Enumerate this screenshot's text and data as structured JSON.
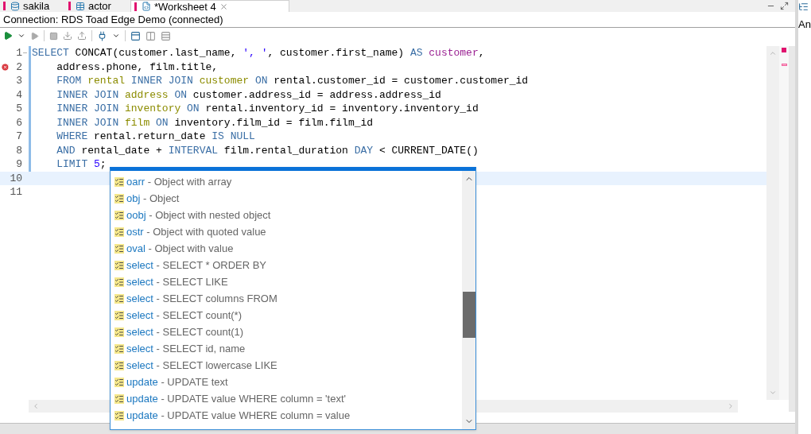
{
  "tabs": [
    {
      "label": "sakila",
      "selected": false,
      "closable": false
    },
    {
      "label": "actor",
      "selected": false,
      "closable": false
    },
    {
      "label": "*Worksheet 4",
      "selected": true,
      "closable": true
    }
  ],
  "connection": "Connection: RDS Toad Edge Demo (connected)",
  "editor": {
    "lines": [
      {
        "number": "1",
        "error": false,
        "changed": true,
        "folding": true,
        "current": false,
        "tokens": [
          {
            "kind": "keyword",
            "text": "SELECT"
          },
          {
            "kind": "plain",
            "text": " CONCAT(customer.last_name, "
          },
          {
            "kind": "string",
            "text": "', '"
          },
          {
            "kind": "plain",
            "text": ", customer.first_name) "
          },
          {
            "kind": "keyword",
            "text": "AS"
          },
          {
            "kind": "alias",
            "text": " customer"
          },
          {
            "kind": "plain",
            "text": ","
          }
        ]
      },
      {
        "number": "2",
        "error": true,
        "changed": true,
        "folding": false,
        "current": false,
        "tokens": [
          {
            "kind": "plain",
            "text": "    address.phone, film.title,"
          }
        ]
      },
      {
        "number": "3",
        "error": false,
        "changed": true,
        "folding": false,
        "current": false,
        "tokens": [
          {
            "kind": "keyword",
            "text": "    FROM"
          },
          {
            "kind": "table",
            "text": " rental"
          },
          {
            "kind": "keyword",
            "text": " INNER JOIN"
          },
          {
            "kind": "table",
            "text": " customer"
          },
          {
            "kind": "keyword",
            "text": " ON"
          },
          {
            "kind": "plain",
            "text": " rental.customer_id = customer.customer_id"
          }
        ]
      },
      {
        "number": "4",
        "error": false,
        "changed": true,
        "folding": false,
        "current": false,
        "tokens": [
          {
            "kind": "keyword",
            "text": "    INNER JOIN"
          },
          {
            "kind": "table",
            "text": " address"
          },
          {
            "kind": "keyword",
            "text": " ON"
          },
          {
            "kind": "plain",
            "text": " customer.address_id = address.address_id"
          }
        ]
      },
      {
        "number": "5",
        "error": false,
        "changed": true,
        "folding": false,
        "current": false,
        "tokens": [
          {
            "kind": "keyword",
            "text": "    INNER JOIN"
          },
          {
            "kind": "table",
            "text": " inventory"
          },
          {
            "kind": "keyword",
            "text": " ON"
          },
          {
            "kind": "plain",
            "text": " rental.inventory_id = inventory.inventory_id"
          }
        ]
      },
      {
        "number": "6",
        "error": false,
        "changed": true,
        "folding": false,
        "current": false,
        "tokens": [
          {
            "kind": "keyword",
            "text": "    INNER JOIN"
          },
          {
            "kind": "table",
            "text": " film"
          },
          {
            "kind": "keyword",
            "text": " ON"
          },
          {
            "kind": "plain",
            "text": " inventory.film_id = film.film_id"
          }
        ]
      },
      {
        "number": "7",
        "error": false,
        "changed": true,
        "folding": false,
        "current": false,
        "tokens": [
          {
            "kind": "keyword",
            "text": "    WHERE"
          },
          {
            "kind": "plain",
            "text": " rental.return_date "
          },
          {
            "kind": "keyword",
            "text": "IS NULL"
          }
        ]
      },
      {
        "number": "8",
        "error": false,
        "changed": true,
        "folding": false,
        "current": false,
        "tokens": [
          {
            "kind": "keyword",
            "text": "    AND"
          },
          {
            "kind": "plain",
            "text": " rental_date + "
          },
          {
            "kind": "keyword",
            "text": "INTERVAL"
          },
          {
            "kind": "plain",
            "text": " film.rental_duration "
          },
          {
            "kind": "keyword",
            "text": "DAY"
          },
          {
            "kind": "plain",
            "text": " < CURRENT_DATE()"
          }
        ]
      },
      {
        "number": "9",
        "error": false,
        "changed": true,
        "folding": false,
        "current": false,
        "tokens": [
          {
            "kind": "keyword",
            "text": "    LIMIT"
          },
          {
            "kind": "number",
            "text": " 5"
          },
          {
            "kind": "plain",
            "text": ";"
          }
        ]
      },
      {
        "number": "10",
        "error": false,
        "changed": false,
        "folding": false,
        "current": true
      },
      {
        "number": "11",
        "error": false,
        "changed": false,
        "folding": false,
        "current": false
      }
    ]
  },
  "completion": [
    {
      "name": "oarr",
      "description": " - Object with array"
    },
    {
      "name": "obj",
      "description": " - Object"
    },
    {
      "name": "oobj",
      "description": " - Object with nested object"
    },
    {
      "name": "ostr",
      "description": " - Object with quoted value"
    },
    {
      "name": "oval",
      "description": " - Object with value"
    },
    {
      "name": "select",
      "description": " - SELECT * ORDER BY"
    },
    {
      "name": "select",
      "description": " - SELECT LIKE"
    },
    {
      "name": "select",
      "description": " - SELECT columns FROM"
    },
    {
      "name": "select",
      "description": " - SELECT count(*)"
    },
    {
      "name": "select",
      "description": " - SELECT count(1)"
    },
    {
      "name": "select",
      "description": " - SELECT id, name"
    },
    {
      "name": "select",
      "description": " - SELECT lowercase LIKE"
    },
    {
      "name": "update",
      "description": " - UPDATE text"
    },
    {
      "name": "update",
      "description": " - UPDATE value WHERE column = 'text'"
    },
    {
      "name": "update",
      "description": " - UPDATE value WHERE column = value"
    }
  ],
  "side_panel": {
    "label": "An"
  }
}
